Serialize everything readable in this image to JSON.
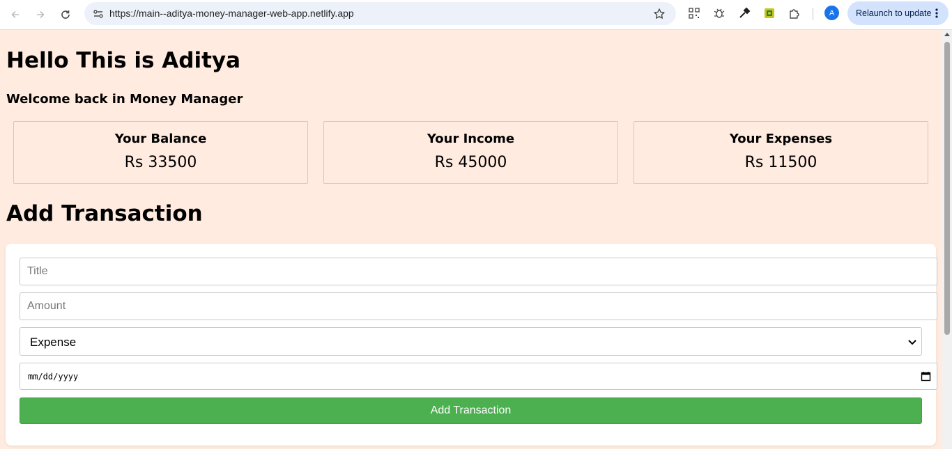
{
  "browser": {
    "url": "https://main--aditya-money-manager-web-app.netlify.app",
    "profile_initial": "A",
    "relaunch_label": "Relaunch to update",
    "extension_icons": [
      "qr-code-icon",
      "bug-icon",
      "eyedropper-icon",
      "extension-green-icon",
      "puzzle-icon"
    ]
  },
  "page": {
    "heading": "Hello This is Aditya",
    "subheading": "Welcome back in Money Manager",
    "background_color": "#ffebdf",
    "summary_cards": [
      {
        "title": "Your Balance",
        "value": "Rs 33500"
      },
      {
        "title": "Your Income",
        "value": "Rs 45000"
      },
      {
        "title": "Your Expenses",
        "value": "Rs 11500"
      }
    ],
    "form": {
      "heading": "Add Transaction",
      "title_placeholder": "Title",
      "amount_placeholder": "Amount",
      "type_selected": "Expense",
      "date_placeholder": "mm/dd/yyyy",
      "submit_label": "Add Transaction",
      "submit_color": "#4caf50"
    }
  }
}
